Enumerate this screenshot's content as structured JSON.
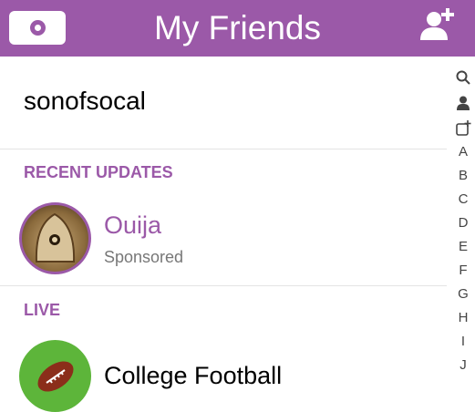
{
  "header": {
    "title": "My Friends"
  },
  "search": {
    "value": "sonofsocal"
  },
  "sections": {
    "recent": "RECENT UPDATES",
    "live": "LIVE"
  },
  "recent_items": [
    {
      "name": "Ouija",
      "subtitle": "Sponsored"
    }
  ],
  "live_items": [
    {
      "name": "College Football"
    }
  ],
  "index": {
    "icons": [
      "search-icon",
      "person-icon",
      "story-add-icon"
    ],
    "letters": [
      "A",
      "B",
      "C",
      "D",
      "E",
      "F",
      "G",
      "H",
      "I",
      "J"
    ]
  },
  "colors": {
    "accent": "#9b59a8",
    "football_green": "#5db53a"
  }
}
